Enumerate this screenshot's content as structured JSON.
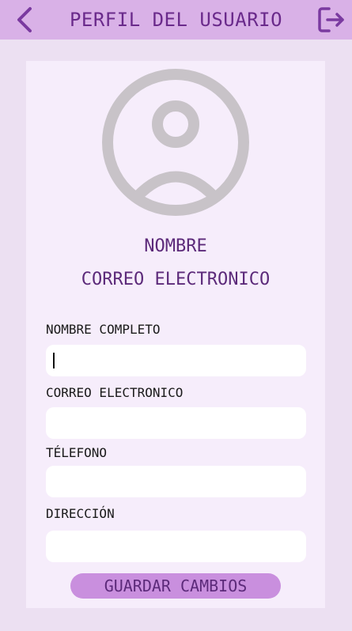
{
  "header": {
    "title": "PERFIL DEL USUARIO",
    "back_icon": "chevron-left-icon",
    "logout_icon": "logout-icon",
    "background": "#d9b1e7",
    "accent": "#6a2a8b"
  },
  "profile": {
    "avatar_icon": "user-circle-icon",
    "name": "NOMBRE",
    "email": "CORREO ELECTRONICO"
  },
  "form": {
    "full_name": {
      "label": "NOMBRE COMPLETO",
      "value": ""
    },
    "email": {
      "label": "CORREO ELECTRONICO",
      "value": ""
    },
    "phone": {
      "label": "TÉLEFONO",
      "value": ""
    },
    "address": {
      "label": "DIRECCIÓN",
      "value": ""
    },
    "save_label": "GUARDAR CAMBIOS"
  },
  "colors": {
    "page_background": "#ece0f2",
    "card_background": "#f6edfb",
    "button_background": "#c98fde",
    "avatar_gray": "#c8c3c8"
  }
}
